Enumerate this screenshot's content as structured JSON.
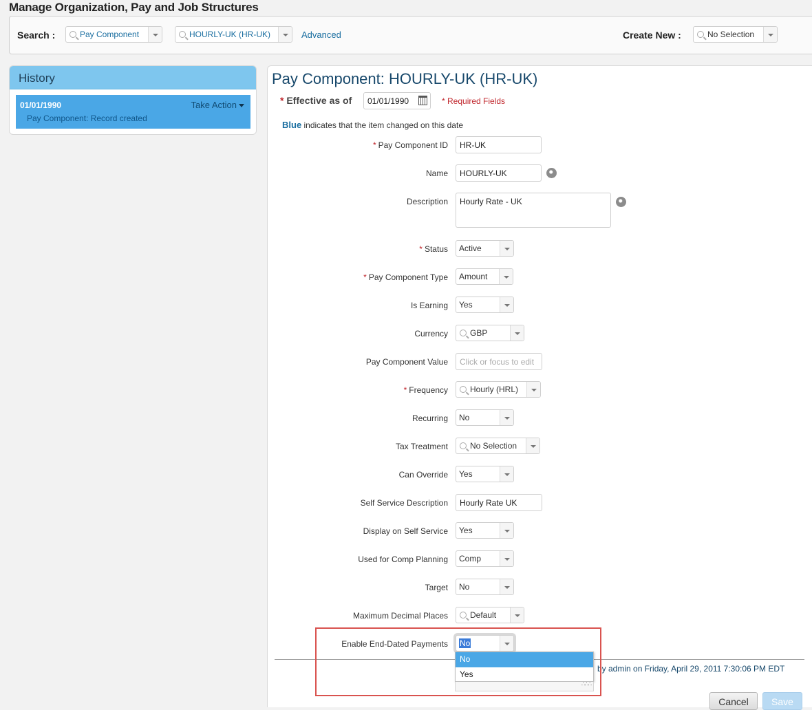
{
  "page_title": "Manage Organization, Pay and Job Structures",
  "search": {
    "label": "Search :",
    "type_value": "Pay Component",
    "item_value": "HOURLY-UK (HR-UK)",
    "advanced_link": "Advanced",
    "create_new_label": "Create New :",
    "create_new_value": "No Selection"
  },
  "history": {
    "title": "History",
    "item": {
      "date": "01/01/1990",
      "action": "Take Action",
      "description": "Pay Component: Record created"
    }
  },
  "form": {
    "title": "Pay Component: HOURLY-UK (HR-UK)",
    "effective_label": "Effective as of",
    "effective_date": "01/01/1990",
    "required_note": "* Required Fields",
    "legend_blue": "Blue",
    "legend_text": " indicates that the item changed on this date",
    "required_marker": "*",
    "fields": {
      "pay_component_id": {
        "label": "Pay Component ID",
        "value": "HR-UK"
      },
      "name": {
        "label": "Name",
        "value": "HOURLY-UK"
      },
      "description": {
        "label": "Description",
        "value": "Hourly Rate - UK"
      },
      "status": {
        "label": "Status",
        "value": "Active"
      },
      "pay_component_type": {
        "label": "Pay Component Type",
        "value": "Amount"
      },
      "is_earning": {
        "label": "Is Earning",
        "value": "Yes"
      },
      "currency": {
        "label": "Currency",
        "value": "GBP"
      },
      "pay_component_value": {
        "label": "Pay Component Value",
        "placeholder": "Click or focus to edit"
      },
      "frequency": {
        "label": "Frequency",
        "value": "Hourly (HRL)"
      },
      "recurring": {
        "label": "Recurring",
        "value": "No"
      },
      "tax_treatment": {
        "label": "Tax Treatment",
        "value": "No Selection"
      },
      "can_override": {
        "label": "Can Override",
        "value": "Yes"
      },
      "self_service_description": {
        "label": "Self Service Description",
        "value": "Hourly Rate UK"
      },
      "display_on_self_service": {
        "label": "Display on Self Service",
        "value": "Yes"
      },
      "used_for_comp_planning": {
        "label": "Used for Comp Planning",
        "value": "Comp"
      },
      "target": {
        "label": "Target",
        "value": "No"
      },
      "maximum_decimal_places": {
        "label": "Maximum Decimal Places",
        "value": "Default"
      },
      "enable_end_dated_payments": {
        "label": "Enable End-Dated Payments",
        "value": "No",
        "options": [
          "No",
          "Yes"
        ]
      }
    },
    "audit_text": "by admin on Friday, April 29, 2011 7:30:06 PM EDT",
    "cancel_label": "Cancel",
    "save_label": "Save"
  }
}
